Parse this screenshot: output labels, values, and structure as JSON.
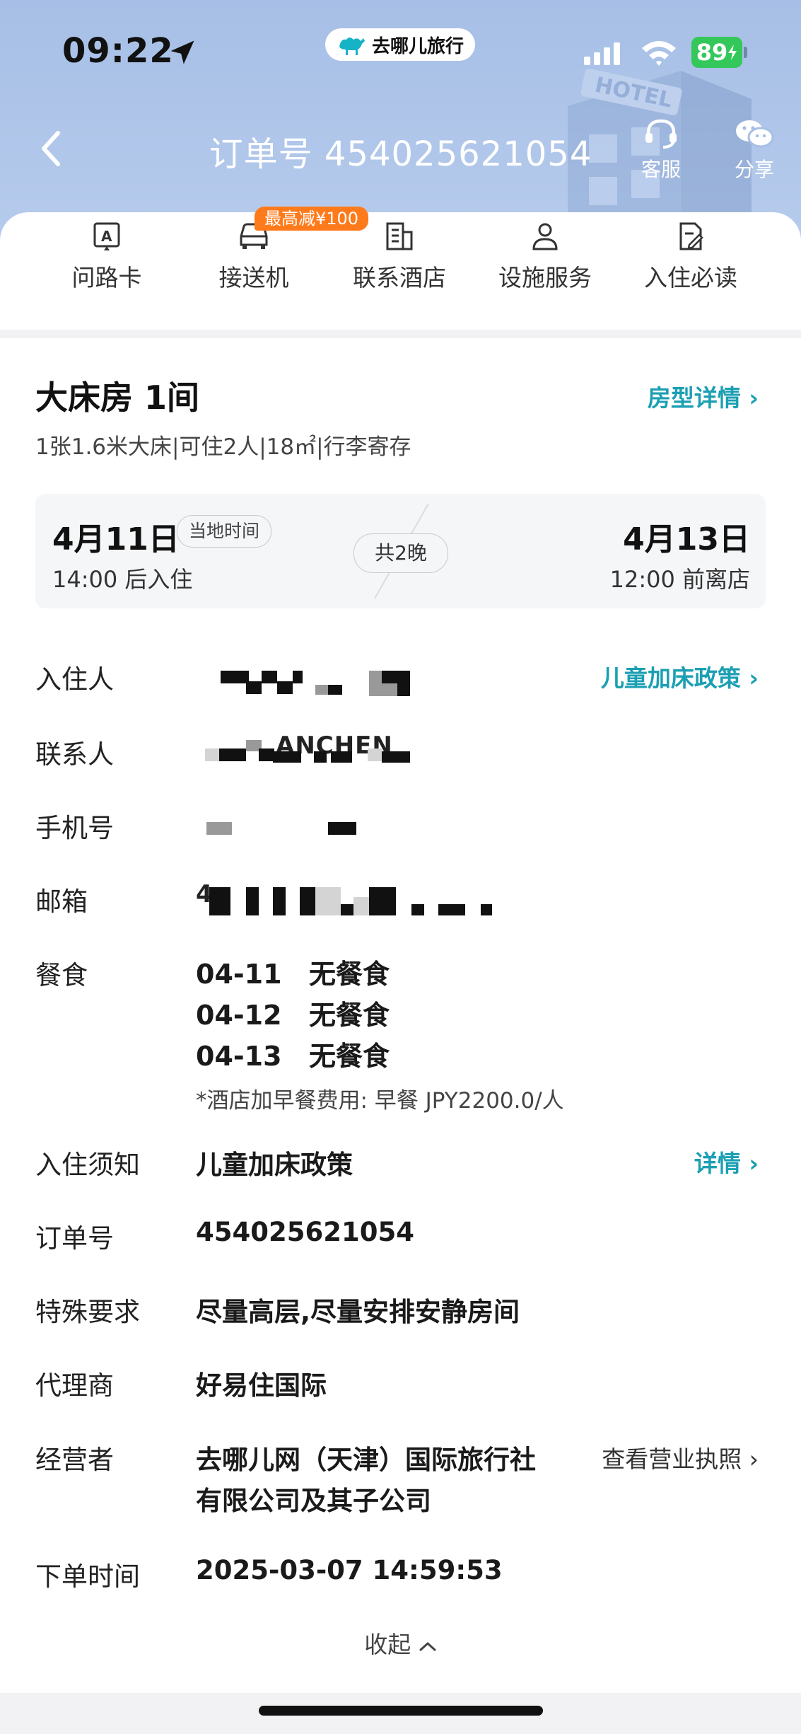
{
  "status_bar": {
    "time": "09:22",
    "app_pill": "去哪儿旅行",
    "battery": "89"
  },
  "nav": {
    "title": "订单号 454025621054",
    "customer_service": "客服",
    "share": "分享"
  },
  "shortcuts": {
    "items": [
      {
        "label": "问路卡",
        "icon": "direction-card-icon"
      },
      {
        "label": "接送机",
        "icon": "car-icon"
      },
      {
        "label": "联系酒店",
        "icon": "building-icon"
      },
      {
        "label": "设施服务",
        "icon": "person-icon"
      },
      {
        "label": "入住必读",
        "icon": "document-icon"
      }
    ],
    "promo_badge": "最高减¥100"
  },
  "room": {
    "title": "大床房 1间",
    "detail_link": "房型详情",
    "spec": "1张1.6米大床|可住2人|18㎡|行李寄存"
  },
  "stay": {
    "checkin_date": "4月11日",
    "timezone_tag": "当地时间",
    "checkin_time": "14:00 后入住",
    "nights": "共2晚",
    "checkout_date": "4月13日",
    "checkout_time": "12:00 前离店"
  },
  "fields": {
    "guest_label": "入住人",
    "child_policy_link": "儿童加床政策",
    "contact_label": "联系人",
    "contact_partial": "ANCHEN",
    "phone_label": "手机号",
    "email_label": "邮箱",
    "email_partial": "4",
    "meals_label": "餐食",
    "meals": [
      {
        "date": "04-11",
        "meal": "无餐食"
      },
      {
        "date": "04-12",
        "meal": "无餐食"
      },
      {
        "date": "04-13",
        "meal": "无餐食"
      }
    ],
    "meal_note": "*酒店加早餐费用:  早餐 JPY2200.0/人",
    "notice_label": "入住须知",
    "notice_value": "儿童加床政策",
    "notice_link": "详情",
    "order_label": "订单号",
    "order_value": "454025621054",
    "special_label": "特殊要求",
    "special_value": "尽量高层,尽量安排安静房间",
    "agent_label": "代理商",
    "agent_value": "好易住国际",
    "operator_label": "经营者",
    "operator_value_line1": "去哪儿网（天津）国际旅行社",
    "operator_value_line2": "有限公司及其子公司",
    "license_link": "查看营业执照",
    "order_time_label": "下单时间",
    "order_time_value": "2025-03-07 14:59:53"
  },
  "collapse_label": "收起",
  "colors": {
    "header": "#a7bfe6",
    "teal_link": "#1b9fb3",
    "promo": "#ff7a1a",
    "battery": "#34c759"
  }
}
